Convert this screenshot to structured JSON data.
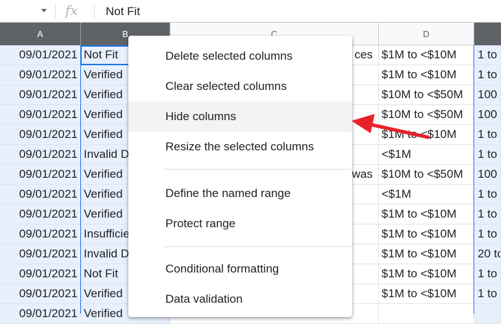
{
  "formula_bar": {
    "fx_label": "fx",
    "value": "Not Fit"
  },
  "columns": [
    "A",
    "B",
    "C",
    "D",
    ""
  ],
  "rows": [
    {
      "a": "09/01/2021",
      "b": "Not Fit",
      "c": "ces",
      "d": "$1M to <$10M",
      "e": "1 to"
    },
    {
      "a": "09/01/2021",
      "b": "Verified",
      "c": "",
      "d": "$1M to <$10M",
      "e": "1 to"
    },
    {
      "a": "09/01/2021",
      "b": "Verified",
      "c": "",
      "d": "$10M to <$50M",
      "e": "100"
    },
    {
      "a": "09/01/2021",
      "b": "Verified",
      "c": "",
      "d": "$10M to <$50M",
      "e": "100"
    },
    {
      "a": "09/01/2021",
      "b": "Verified",
      "c": "",
      "d": "$1M to <$10M",
      "e": "1 to"
    },
    {
      "a": "09/01/2021",
      "b": "Invalid D",
      "c": "",
      "d": "<$1M",
      "e": "1 to"
    },
    {
      "a": "09/01/2021",
      "b": "Verified",
      "c": "Owas",
      "d": "$10M to <$50M",
      "e": "100"
    },
    {
      "a": "09/01/2021",
      "b": "Verified",
      "c": "",
      "d": "<$1M",
      "e": "1 to"
    },
    {
      "a": "09/01/2021",
      "b": "Verified",
      "c": "",
      "d": "$1M to <$10M",
      "e": "1 to"
    },
    {
      "a": "09/01/2021",
      "b": "Insufficie",
      "c": "",
      "d": "$1M to <$10M",
      "e": "1 to"
    },
    {
      "a": "09/01/2021",
      "b": "Invalid D",
      "c": "",
      "d": "$1M to <$10M",
      "e": "20 to"
    },
    {
      "a": "09/01/2021",
      "b": "Not Fit",
      "c": "",
      "d": "$1M to <$10M",
      "e": "1 to"
    },
    {
      "a": "09/01/2021",
      "b": "Verified",
      "c": "",
      "d": "$1M to <$10M",
      "e": "1 to"
    },
    {
      "a": "09/01/2021",
      "b": "Verified",
      "c": "",
      "d": "",
      "e": ""
    }
  ],
  "context_menu": {
    "items": [
      "Delete selected columns",
      "Clear selected columns",
      "Hide columns",
      "Resize the selected columns",
      "Define the named range",
      "Protect range",
      "Conditional formatting",
      "Data validation"
    ],
    "highlighted": "Hide columns"
  },
  "colors": {
    "accent": "#1a73e8",
    "header": "#5f6368",
    "arrow": "#e8222a"
  }
}
